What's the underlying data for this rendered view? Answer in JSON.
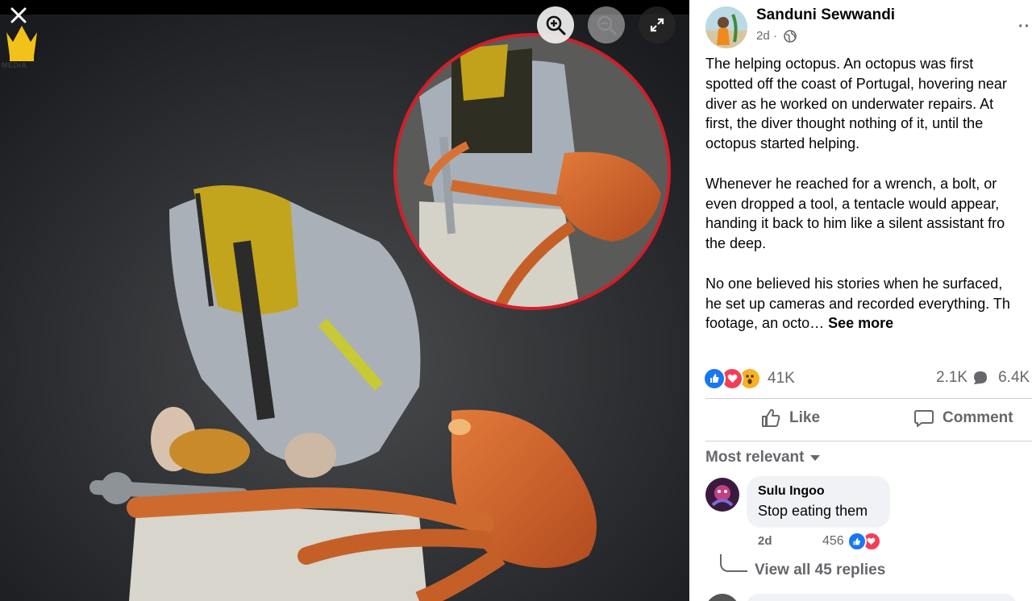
{
  "viewer": {
    "logo_text": "MEDIA",
    "close_icon": "close-icon",
    "controls": [
      "zoom-in-icon",
      "zoom-out-icon",
      "expand-icon"
    ]
  },
  "post": {
    "author": "Sanduni Sewwandi",
    "time": "2d",
    "separator": "·",
    "privacy_icon": "globe-icon",
    "more_label": "··",
    "paragraphs": [
      [
        "The helping octopus. An octopus was first",
        "spotted off the coast of Portugal, hovering near",
        "diver as he worked on underwater repairs. At",
        "first, the diver thought nothing of it, until the",
        "octopus started helping."
      ],
      [
        "Whenever he reached for a wrench, a bolt, or",
        "even dropped a tool, a tentacle would appear,",
        "handing it back to him like a silent assistant fro",
        "the deep."
      ],
      [
        "No one believed his stories when he surfaced,",
        "he set up cameras and recorded everything. Th",
        "footage, an octo…"
      ]
    ],
    "see_more": "See more",
    "reaction_count": "41K",
    "comment_count": "2.1K",
    "share_count": "6.4K",
    "like_label": "Like",
    "comment_label": "Comment",
    "sort_label": "Most relevant"
  },
  "comment": {
    "name": "Sulu Ingoo",
    "text": "Stop eating them",
    "time": "2d",
    "reaction_count": "456",
    "view_replies": "View all 45 replies"
  },
  "colors": {
    "link_gray": "#65676b",
    "like_blue": "#1877f2",
    "love_red": "#f33e58",
    "highlight_circle": "#d11f2a"
  }
}
